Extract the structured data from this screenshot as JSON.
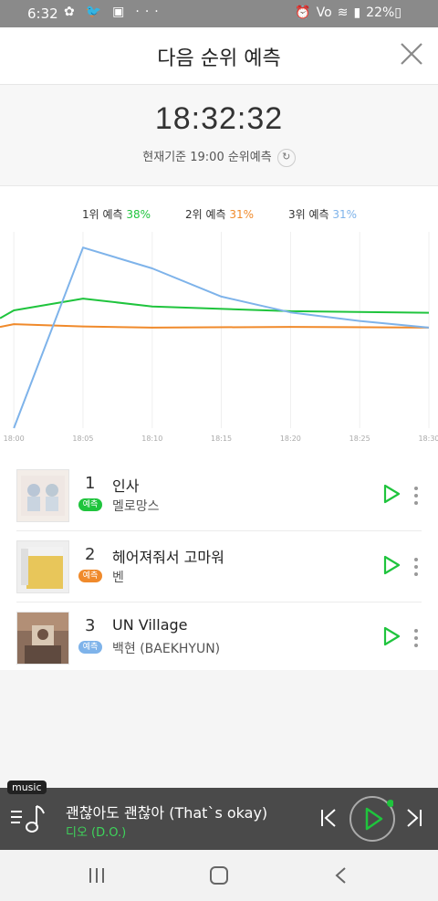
{
  "status": {
    "time": "6:32",
    "battery": "22%"
  },
  "header": {
    "title": "다음 순위 예측"
  },
  "clock": {
    "time": "18:32:32",
    "subtitle": "현재기준 19:00 순위예측"
  },
  "legend": [
    {
      "label": "1위 예측",
      "pct": "38%",
      "color": "#1fc43d"
    },
    {
      "label": "2위 예측",
      "pct": "31%",
      "color": "#f08a2b"
    },
    {
      "label": "3위 예측",
      "pct": "31%",
      "color": "#7eb3ea"
    }
  ],
  "chart_data": {
    "type": "line",
    "x": [
      "18:00",
      "18:05",
      "18:10",
      "18:15",
      "18:20",
      "18:25",
      "18:30"
    ],
    "xlim": [
      "17:59",
      "18:30"
    ],
    "ylim": [
      0,
      50
    ],
    "grid": "vertical lines",
    "series": [
      {
        "name": "1위 예측",
        "color": "#1fc43d",
        "points": [
          [
            "17:59",
            28
          ],
          [
            "18:00",
            30
          ],
          [
            "18:05",
            33
          ],
          [
            "18:10",
            31
          ],
          [
            "18:20",
            29.8
          ],
          [
            "18:30",
            29.4
          ]
        ]
      },
      {
        "name": "2위 예측",
        "color": "#f08a2b",
        "points": [
          [
            "17:59",
            25.8
          ],
          [
            "18:00",
            26.5
          ],
          [
            "18:05",
            25.9
          ],
          [
            "18:10",
            25.6
          ],
          [
            "18:20",
            25.8
          ],
          [
            "18:30",
            25.6
          ]
        ]
      },
      {
        "name": "3위 예측",
        "color": "#7eb3ea",
        "points": [
          [
            "18:00",
            0
          ],
          [
            "18:05",
            46
          ],
          [
            "18:10",
            40.7
          ],
          [
            "18:15",
            33.5
          ],
          [
            "18:20",
            29.5
          ],
          [
            "18:25",
            27.3
          ],
          [
            "18:30",
            25.6
          ]
        ]
      }
    ]
  },
  "songs": [
    {
      "rank": "1",
      "title": "인사",
      "artist": "멜로망스",
      "badge": "예측",
      "badge_color": "#1fc43d"
    },
    {
      "rank": "2",
      "title": "헤어져줘서 고마워",
      "artist": "벤",
      "badge": "예측",
      "badge_color": "#f08a2b"
    },
    {
      "rank": "3",
      "title": "UN Village",
      "artist": "백현 (BAEKHYUN)",
      "badge": "예측",
      "badge_color": "#7eb3ea"
    }
  ],
  "player": {
    "tag": "music",
    "track": "괜찮아도 괜찮아 (That`s okay)",
    "artist": "디오 (D.O.)"
  }
}
